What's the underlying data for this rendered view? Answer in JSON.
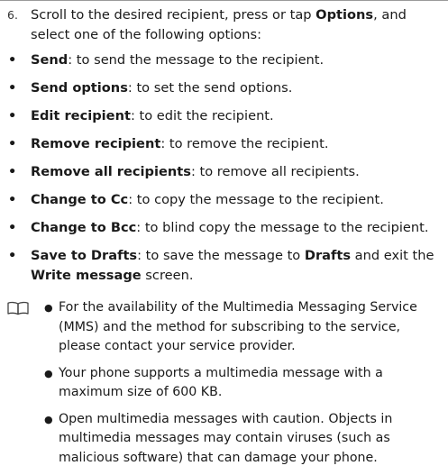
{
  "step": {
    "number": "6.",
    "text_a": "Scroll to the desired recipient, press or tap ",
    "text_b": "Options",
    "text_c": ", and select one of the following options:"
  },
  "options": [
    {
      "term": "Send",
      "desc": ": to send the message to the recipient."
    },
    {
      "term": "Send options",
      "desc": ": to set the send options."
    },
    {
      "term": "Edit recipient",
      "desc": ": to edit the recipient."
    },
    {
      "term": "Remove recipient",
      "desc": ": to remove the recipient."
    },
    {
      "term": "Remove all recipients",
      "desc": ": to remove all recipients."
    },
    {
      "term": "Change to Cc",
      "desc": ": to copy the message to the recipient."
    },
    {
      "term": "Change to Bcc",
      "desc": ": to blind copy the message to the recipient."
    },
    {
      "term": "Save to Drafts",
      "desc": ": to save the message to ",
      "term2": "Drafts",
      "desc2": " and exit the ",
      "term3": "Write message",
      "desc3": " screen."
    }
  ],
  "note": {
    "icon": "book-icon",
    "items": [
      "For the availability of the Multimedia Messaging Service (MMS) and the method for subscribing to the service, please contact your service provider.",
      "Your phone supports a multimedia message with a maximum size of 600 KB.",
      "Open multimedia messages with caution. Objects in multimedia messages may contain viruses (such as malicious software) that can damage your phone."
    ]
  }
}
